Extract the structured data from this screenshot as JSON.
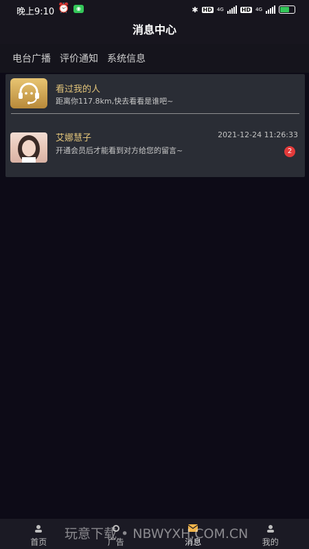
{
  "status_bar": {
    "time": "晚上9:10",
    "hd1": "HD",
    "net1": "4G",
    "hd2": "HD",
    "net2": "4G"
  },
  "header": {
    "title": "消息中心"
  },
  "tabs": [
    {
      "label": "电台广播"
    },
    {
      "label": "评价通知"
    },
    {
      "label": "系统信息"
    }
  ],
  "visitors": {
    "title": "看过我的人",
    "subtitle": "距离你117.8km,快去看看是谁吧~"
  },
  "conversation": {
    "name": "艾娜慧子",
    "time": "2021-12-24 11:26:33",
    "message": "开通会员后才能看到对方给您的留言~",
    "unread": "2"
  },
  "bottom_nav": [
    {
      "label": "首页",
      "icon": "home-icon"
    },
    {
      "label": "广告",
      "icon": "ad-icon"
    },
    {
      "label": "消息",
      "icon": "mail-icon"
    },
    {
      "label": "我的",
      "icon": "profile-icon"
    }
  ],
  "watermark": "玩意下载 • NBWYXH.COM.CN",
  "colors": {
    "accent_gold": "#e2c47a",
    "badge_red": "#e33a3a",
    "background": "#0d0b17"
  }
}
